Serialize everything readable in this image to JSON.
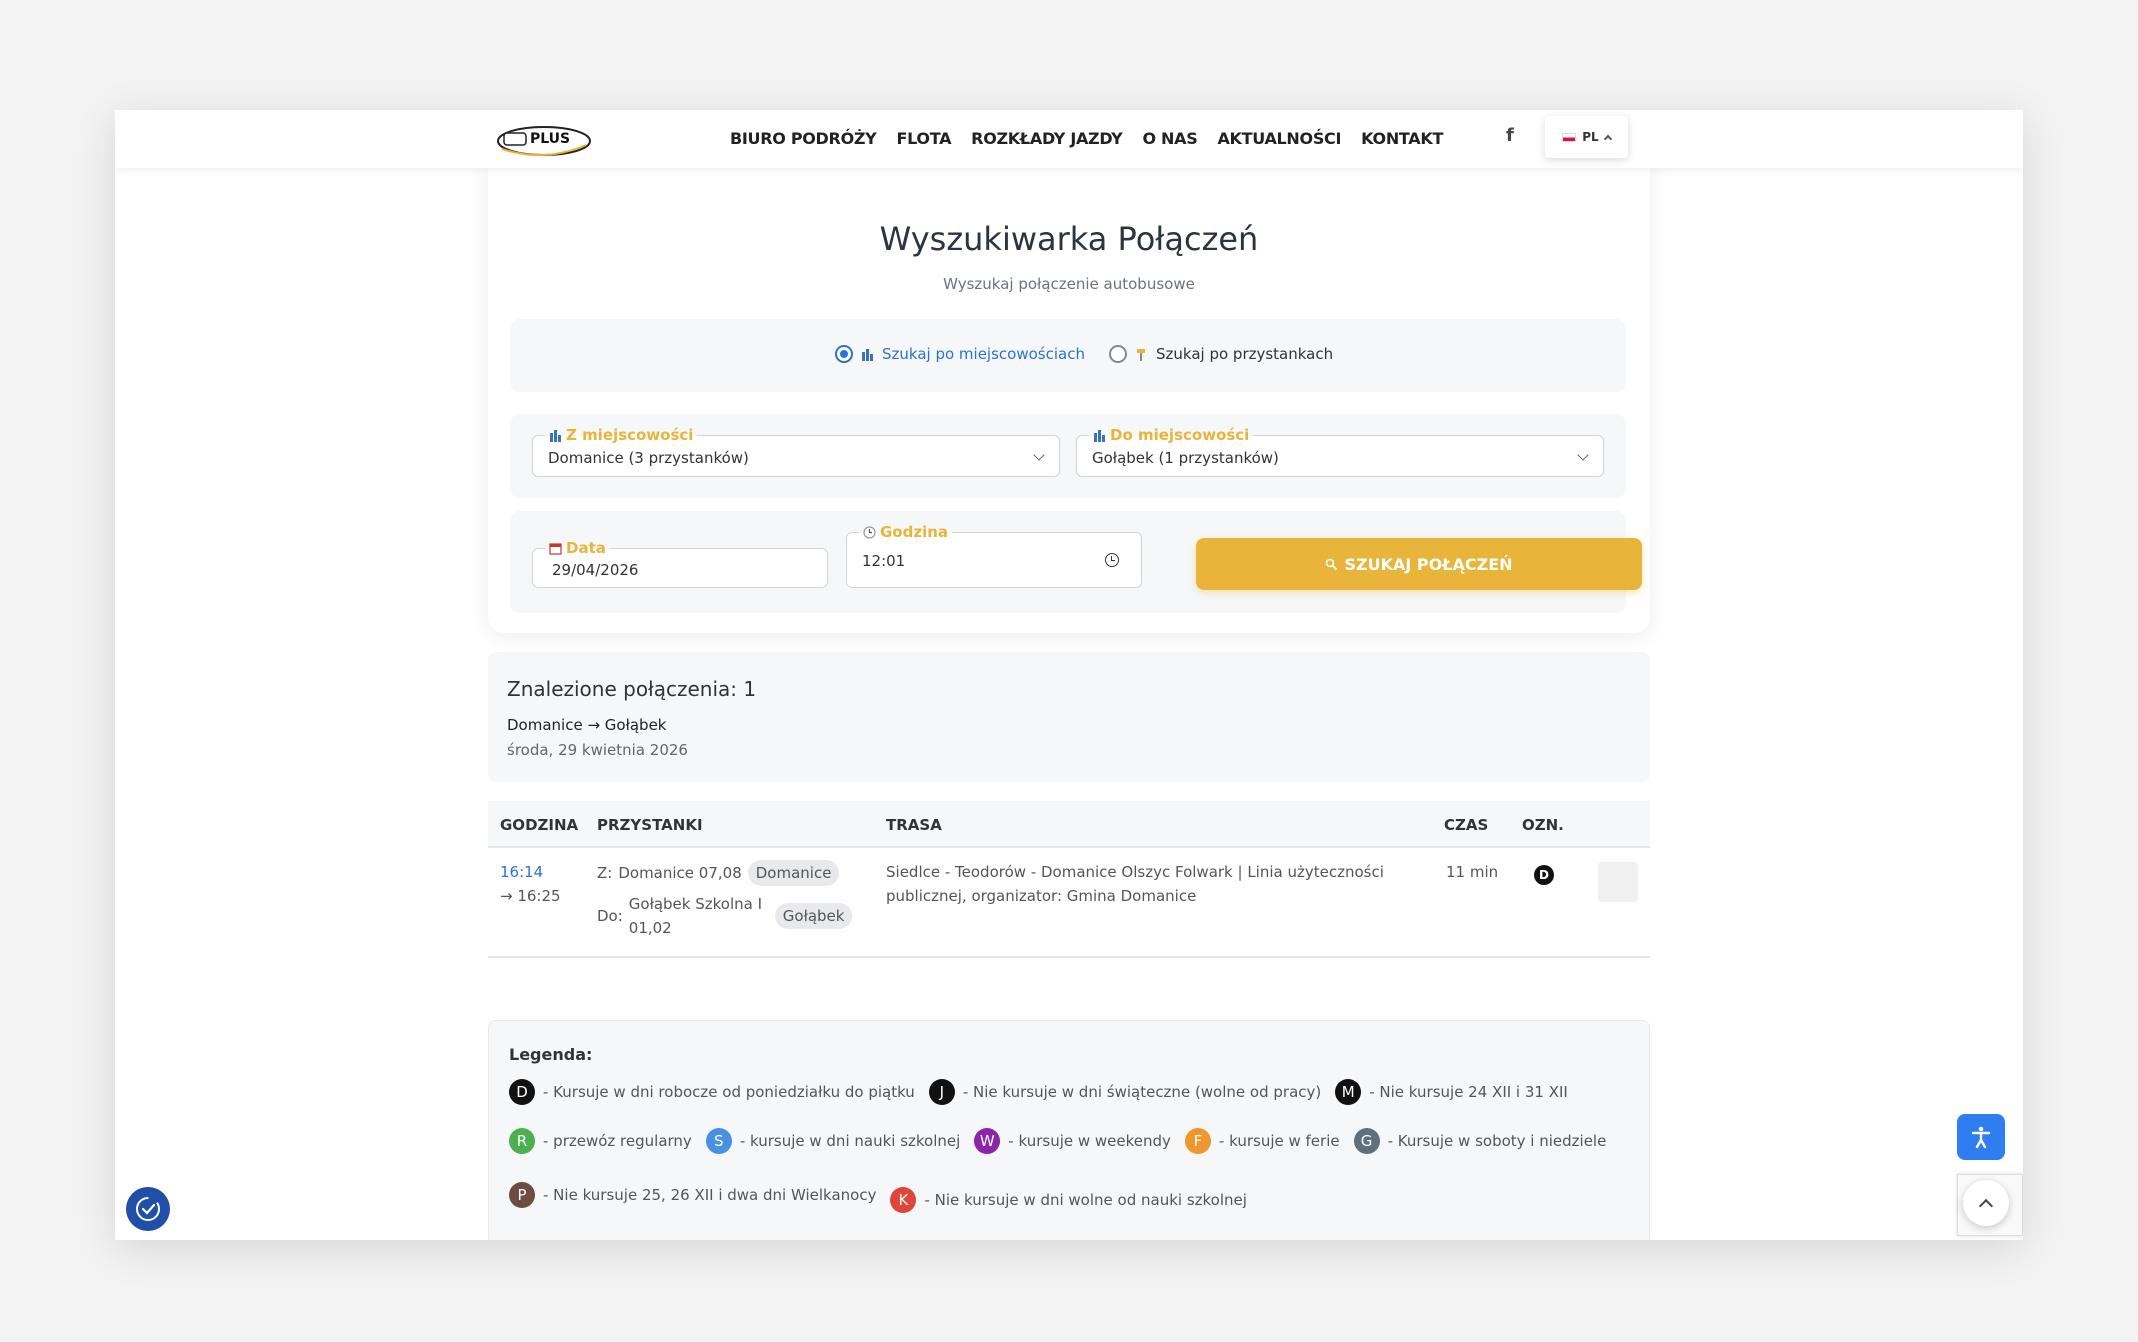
{
  "header": {
    "logo_text": "PLUS",
    "nav": [
      "BIURO PODRÓŻY",
      "FLOTA",
      "ROZKŁADY JAZDY",
      "O NAS",
      "AKTUALNOŚCI",
      "KONTAKT"
    ],
    "facebook_glyph": "f",
    "lang": "PL"
  },
  "search": {
    "title": "Wyszukiwarka Połączeń",
    "subtitle": "Wyszukaj połączenie autobusowe",
    "mode_cities": "Szukaj po miejscowościach",
    "mode_stops": "Szukaj po przystankach",
    "from_label": "Z miejscowości",
    "from_value": "Domanice (3 przystanków)",
    "to_label": "Do miejscowości",
    "to_value": "Gołąbek (1 przystanków)",
    "date_label": "Data",
    "date_value": "29/04/2026",
    "time_label": "Godzina",
    "time_value": "12:01",
    "button": "SZUKAJ POŁĄCZEŃ"
  },
  "results": {
    "found": "Znalezione połączenia: 1",
    "route": "Domanice → Gołąbek",
    "date": "środa, 29 kwietnia 2026"
  },
  "table": {
    "headers": [
      "GODZINA",
      "PRZYSTANKI",
      "TRASA",
      "CZAS",
      "OZN."
    ],
    "rows": [
      {
        "dep": "16:14",
        "arr": "→ 16:25",
        "from_prefix": "Z:",
        "from_stop": "Domanice 07,08",
        "from_chip": "Domanice",
        "to_prefix": "Do:",
        "to_stop_1": "Gołąbek Szkolna I",
        "to_stop_2": "01,02",
        "to_chip": "Gołąbek",
        "route": "Siedlce - Teodorów - Domanice Olszyc Folwark | Linia użyteczności",
        "route_2": "publicznej, organizator: Gmina Domanice",
        "time": "11 min",
        "mark": "D"
      }
    ]
  },
  "legend": {
    "title": "Legenda:",
    "items": [
      {
        "code": "D",
        "text": "- Kursuje w dni robocze od poniedziałku do piątku",
        "color": "#111111"
      },
      {
        "code": "J",
        "text": "- Nie kursuje w dni świąteczne (wolne od pracy)",
        "color": "#111111"
      },
      {
        "code": "M",
        "text": "- Nie kursuje 24 XII i 31 XII",
        "color": "#111111"
      },
      {
        "code": "R",
        "text": "- przewóz regularny",
        "color": "#4caf50"
      },
      {
        "code": "S",
        "text": "- kursuje w dni nauki szkolnej",
        "color": "#4a90e2"
      },
      {
        "code": "W",
        "text": "- kursuje w weekendy",
        "color": "#8e24aa"
      },
      {
        "code": "F",
        "text": "- kursuje w ferie",
        "color": "#f0962e"
      },
      {
        "code": "G",
        "text": "- Kursuje w soboty i niedziele",
        "color": "#5f6f7c"
      },
      {
        "code": "P",
        "text": "- Nie kursuje 25, 26 XII i dwa dni Wielkanocy",
        "color": "#6d4c41"
      },
      {
        "code": "K",
        "text": "- Nie kursuje w dni wolne od nauki szkolnej",
        "color": "#e0453a"
      }
    ]
  },
  "colors": {
    "accent": "#e8b53a",
    "link": "#2a72d4",
    "accessibility": "#2f7ef0"
  },
  "icons": [
    "facebook-icon",
    "chevron-up-icon",
    "city-icon",
    "stop-icon",
    "chevron-down-icon",
    "calendar-icon",
    "clock-icon",
    "search-icon",
    "accessibility-icon",
    "arrow-up-icon",
    "cookie-settings-icon"
  ]
}
